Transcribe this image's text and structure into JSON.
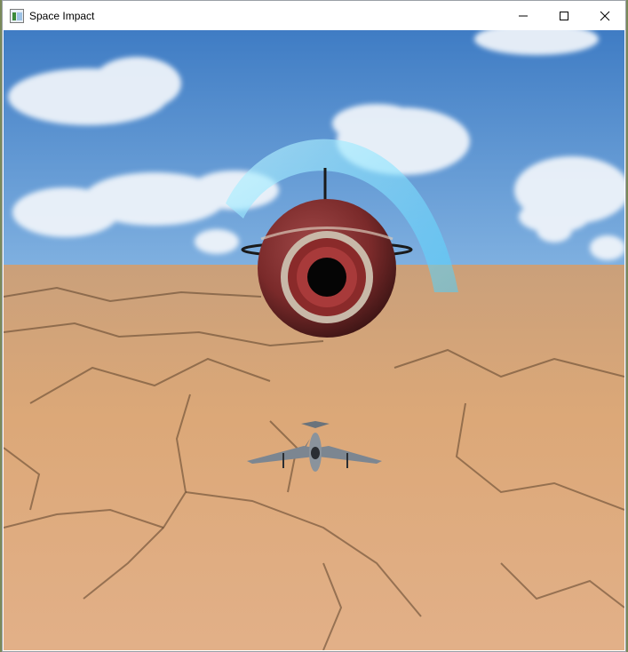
{
  "window": {
    "title": "Space Impact",
    "icon": "app-window-icon",
    "controls": [
      "minimize-icon",
      "maximize-icon",
      "close-icon"
    ]
  },
  "scene": {
    "sky_color": "#4a86c8",
    "ground_color": "#d9a26e",
    "enemy": "red-spherical-mine",
    "shield": "cyan-energy-arc",
    "player": "grey-jet-fighter"
  }
}
